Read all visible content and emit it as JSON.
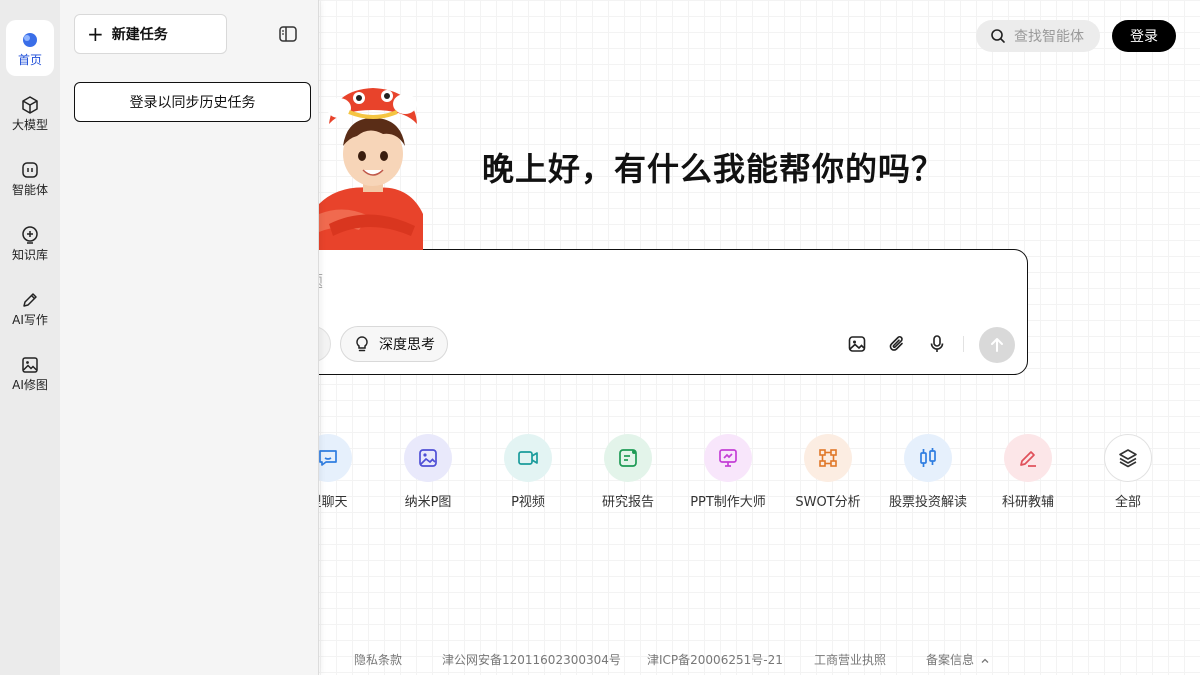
{
  "rail": [
    {
      "key": "home",
      "label": "首页",
      "icon": "home-icon",
      "active": true
    },
    {
      "key": "models",
      "label": "大模型",
      "icon": "cube-icon"
    },
    {
      "key": "agents",
      "label": "智能体",
      "icon": "agent-icon"
    },
    {
      "key": "knowledge",
      "label": "知识库",
      "icon": "knowledge-icon"
    },
    {
      "key": "writing",
      "label": "AI写作",
      "icon": "pen-icon"
    },
    {
      "key": "image",
      "label": "AI修图",
      "icon": "image-icon"
    }
  ],
  "drawer": {
    "new_task": "新建任务",
    "login_sync": "登录以同步历史任务"
  },
  "header": {
    "search_placeholder": "查找智能体",
    "login": "登录"
  },
  "main": {
    "greeting": "晚上好，有什么我能帮你的吗？",
    "input_placeholder": "问题",
    "deep_think": "深度思考"
  },
  "shortcuts": [
    {
      "label": "型聊天",
      "icon": "chat-icon",
      "color": "#2f7de1",
      "bg": "#e6f0fc"
    },
    {
      "label": "纳米P图",
      "icon": "photo-edit-icon",
      "color": "#4f4fd6",
      "bg": "#e9e9fb"
    },
    {
      "label": "P视频",
      "icon": "video-icon",
      "color": "#1b9c9c",
      "bg": "#e3f4f3"
    },
    {
      "label": "研究报告",
      "icon": "report-icon",
      "color": "#1e9a55",
      "bg": "#e3f4ea"
    },
    {
      "label": "PPT制作大师",
      "icon": "ppt-icon",
      "color": "#c43fd6",
      "bg": "#f8e6fb"
    },
    {
      "label": "SWOT分析",
      "icon": "swot-icon",
      "color": "#e0782a",
      "bg": "#fcede2"
    },
    {
      "label": "股票投资解读",
      "icon": "stock-icon",
      "color": "#2f7de1",
      "bg": "#e6f0fc"
    },
    {
      "label": "科研教辅",
      "icon": "research-pen-icon",
      "color": "#e0505a",
      "bg": "#fce6e8"
    },
    {
      "label": "全部",
      "icon": "layers-icon",
      "color": "#333333",
      "bg": "#ffffff"
    }
  ],
  "footer": [
    "隐私条款",
    "津公网安备12011602300304号",
    "津ICP备20006251号-21",
    "工商营业执照",
    "备案信息"
  ]
}
